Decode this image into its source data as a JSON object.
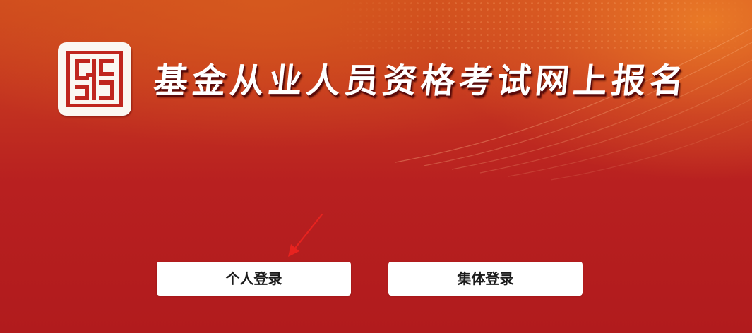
{
  "header": {
    "title": "基金从业人员资格考试网上报名",
    "logo_icon": "seal-logo-icon"
  },
  "buttons": {
    "personal_login": "个人登录",
    "group_login": "集体登录"
  },
  "annotation": {
    "arrow_icon": "pointer-arrow-icon",
    "arrow_color": "#e8231f"
  },
  "colors": {
    "background_top": "#cf4a1e",
    "background_bottom": "#b11b1d",
    "accent_orange": "#ee8228",
    "button_background": "#ffffff",
    "button_text": "#1c1c1c",
    "title_text": "#ffffff"
  }
}
